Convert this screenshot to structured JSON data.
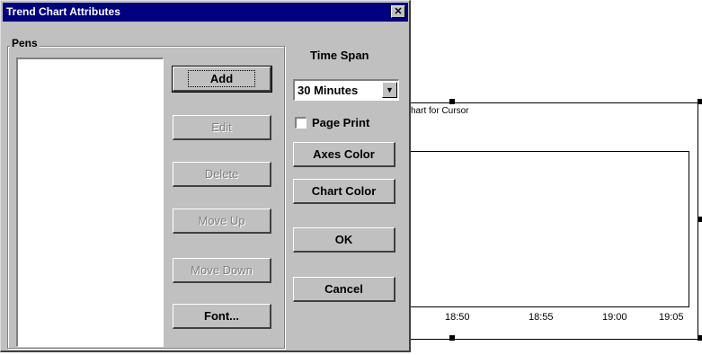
{
  "chart": {
    "title": "hart for Cursor",
    "x_ticks": [
      "18:50",
      "18:55",
      "19:00",
      "19:05"
    ]
  },
  "dialog": {
    "title": "Trend Chart Attributes",
    "close_glyph": "✕",
    "pens_group_label": "Pens",
    "pens_items": [],
    "buttons": {
      "add": "Add",
      "edit": "Edit",
      "delete": "Delete",
      "move_up": "Move Up",
      "move_down": "Move Down",
      "font": "Font...",
      "axes_color": "Axes Color",
      "chart_color": "Chart Color",
      "ok": "OK",
      "cancel": "Cancel"
    },
    "time_span_label": "Time Span",
    "time_span_value": "30 Minutes",
    "page_print_label": "Page Print",
    "page_print_checked": false
  },
  "colors": {
    "titlebar": "#000080",
    "face": "#c0c0c0"
  }
}
